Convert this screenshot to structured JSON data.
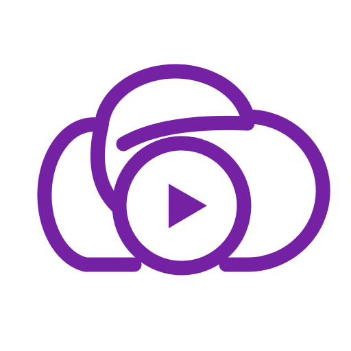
{
  "logo": {
    "icon_name": "cloud-play-icon",
    "colors": {
      "primary": "#7421A4",
      "background": "#FFFFFF"
    }
  }
}
